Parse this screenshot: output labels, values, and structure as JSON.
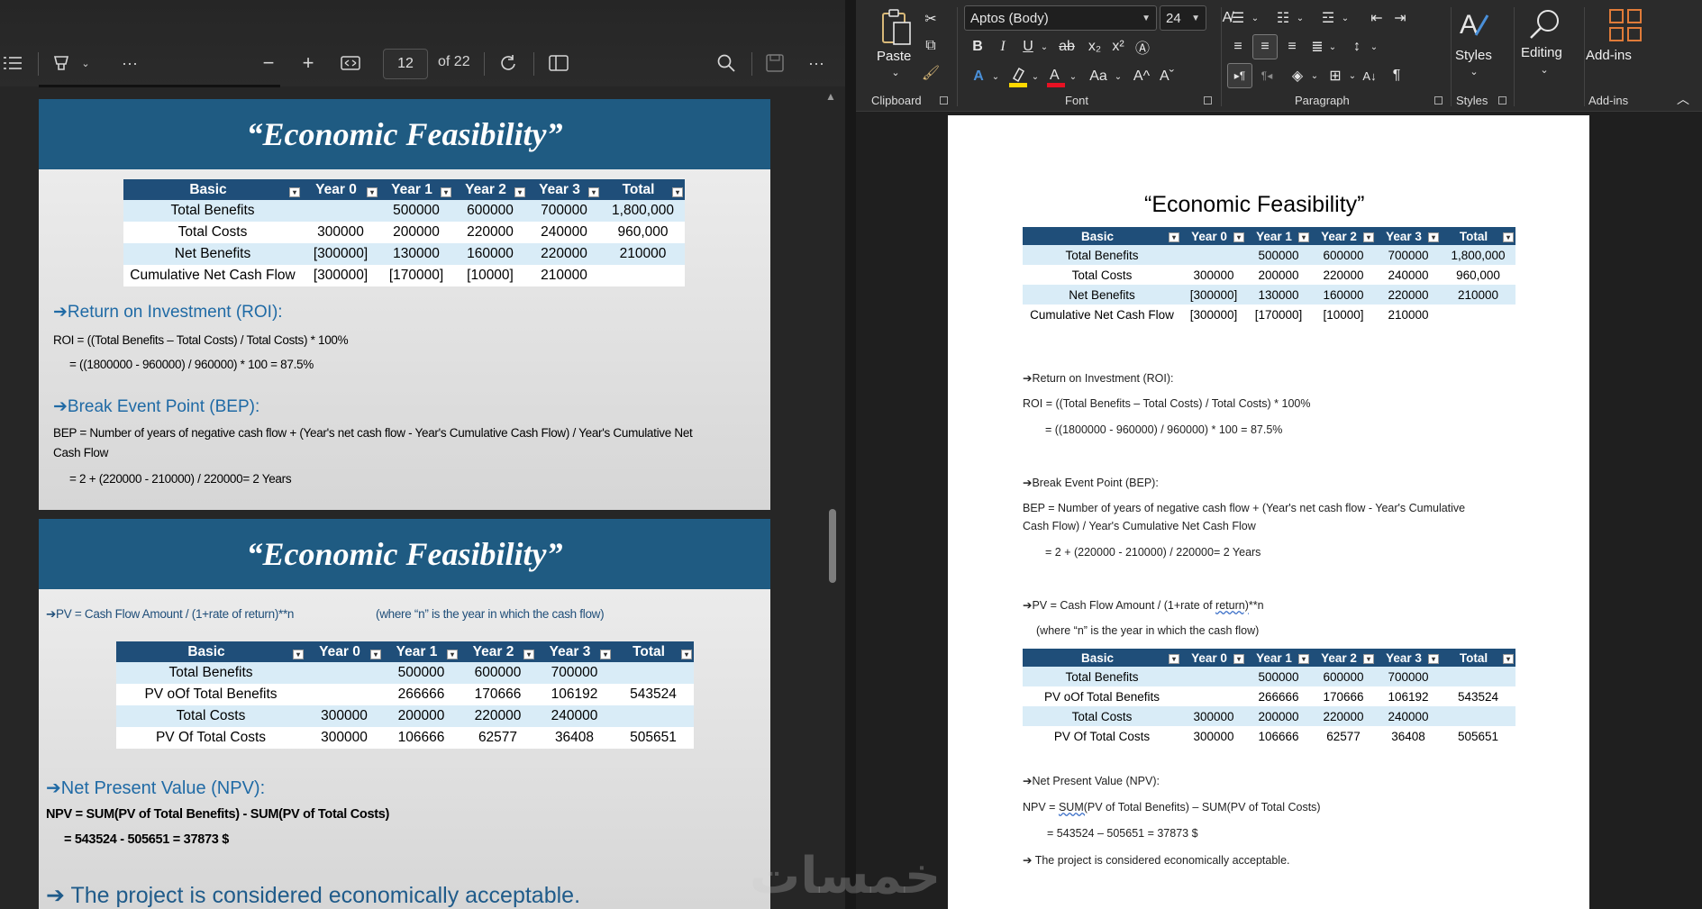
{
  "pdf_viewer": {
    "toolbar": {
      "contents_icon": "list-icon",
      "draw_icon": "highlighter-icon",
      "more_icon": "more-icon",
      "zoom_out_icon": "minus-icon",
      "zoom_in_icon": "plus-icon",
      "fit_icon": "fit-width-icon",
      "page_number": "12",
      "page_of": "of 22",
      "rotate_icon": "rotate-icon",
      "two_page_icon": "page-view-icon",
      "search_icon": "search-icon",
      "save_icon": "save-icon"
    },
    "slide1": {
      "title": "“Economic Feasibility”",
      "table": {
        "headers": [
          "Basic",
          "Year 0",
          "Year 1",
          "Year 2",
          "Year 3",
          "Total"
        ],
        "rows": [
          [
            "Total Benefits",
            "",
            "500000",
            "600000",
            "700000",
            "1,800,000"
          ],
          [
            "Total Costs",
            "300000",
            "200000",
            "220000",
            "240000",
            "960,000"
          ],
          [
            "Net Benefits",
            "[300000]",
            "130000",
            "160000",
            "220000",
            "210000"
          ],
          [
            "Cumulative Net Cash Flow",
            "[300000]",
            "[170000]",
            "[10000]",
            "210000",
            ""
          ]
        ]
      },
      "roi_heading": "➔Return on Investment (ROI):",
      "roi_formula": "ROI = ((Total Benefits – Total Costs) / Total Costs) * 100%",
      "roi_calc": "= ((1800000 - 960000) / 960000) * 100 = 87.5%",
      "bep_heading": "➔Break Event Point (BEP):",
      "bep_formula_1": "BEP = Number of years of negative cash flow + (Year's net cash flow - Year's Cumulative Cash Flow) / Year's Cumulative Net",
      "bep_formula_2": "Cash Flow",
      "bep_calc": "= 2 + (220000 - 210000) / 220000= 2 Years"
    },
    "slide2": {
      "title": "“Economic Feasibility”",
      "pv_formula": "➔PV = Cash Flow Amount / (1+rate of return)**n",
      "pv_note": "(where “n” is the year in which the cash flow)",
      "table": {
        "headers": [
          "Basic",
          "Year 0",
          "Year 1",
          "Year 2",
          "Year 3",
          "Total"
        ],
        "rows": [
          [
            "Total Benefits",
            "",
            "500000",
            "600000",
            "700000",
            ""
          ],
          [
            "PV oOf Total Benefits",
            "",
            "266666",
            "170666",
            "106192",
            "543524"
          ],
          [
            "Total Costs",
            "300000",
            "200000",
            "220000",
            "240000",
            ""
          ],
          [
            "PV Of Total Costs",
            "300000",
            "106666",
            "62577",
            "36408",
            "505651"
          ]
        ]
      },
      "npv_heading": "➔Net Present Value (NPV):",
      "npv_formula": "NPV = SUM(PV of Total Benefits) - SUM(PV of Total Costs)",
      "npv_calc": "= 543524 - 505651 = 37873 $",
      "conclusion": "➔ The project is considered economically acceptable."
    }
  },
  "word": {
    "ribbon": {
      "paste_label": "Paste",
      "clipboard_label": "Clipboard",
      "font_name": "Aptos (Body)",
      "font_size": "24",
      "font_label": "Font",
      "paragraph_label": "Paragraph",
      "styles_label": "Styles",
      "styles_button": "Styles",
      "editing_button": "Editing",
      "addins_button": "Add-ins",
      "addins_label": "Add-ins",
      "bold": "B",
      "italic": "I",
      "underline": "U",
      "strike": "ab",
      "subscript": "x₂",
      "superscript": "x²",
      "change_case": "Aa",
      "grow": "A^",
      "shrink": "Aˇ",
      "colors": {
        "highlight": "#ffd800",
        "font_color": "#e81123",
        "accent": "#4a90d9"
      }
    },
    "document": {
      "title": "“Economic Feasibility”",
      "table1": {
        "headers": [
          "Basic",
          "Year 0",
          "Year 1",
          "Year 2",
          "Year 3",
          "Total"
        ],
        "rows": [
          [
            "Total Benefits",
            "",
            "500000",
            "600000",
            "700000",
            "1,800,000"
          ],
          [
            "Total Costs",
            "300000",
            "200000",
            "220000",
            "240000",
            "960,000"
          ],
          [
            "Net Benefits",
            "[300000]",
            "130000",
            "160000",
            "220000",
            "210000"
          ],
          [
            "Cumulative Net Cash Flow",
            "[300000]",
            "[170000]",
            "[10000]",
            "210000",
            ""
          ]
        ]
      },
      "roi_heading": "➔Return on Investment (ROI):",
      "roi_formula": "ROI = ((Total Benefits – Total Costs) / Total Costs) * 100%",
      "roi_calc": "= ((1800000 - 960000) / 960000) * 100 = 87.5%",
      "bep_heading": "➔Break Event Point (BEP):",
      "bep_formula_1": "BEP = Number of years of negative cash flow + (Year's net cash flow - Year's Cumulative",
      "bep_formula_2": "Cash Flow) / Year's Cumulative Net Cash Flow",
      "bep_calc": "= 2 + (220000 - 210000) / 220000= 2 Years",
      "pv_formula_a": "➔PV = Cash Flow Amount / (1+rate of ",
      "pv_formula_b": "return)",
      "pv_formula_c": "**n",
      "pv_note": "(where “n” is the year in which the cash flow)",
      "table2": {
        "headers": [
          "Basic",
          "Year 0",
          "Year 1",
          "Year 2",
          "Year 3",
          "Total"
        ],
        "rows": [
          [
            "Total Benefits",
            "",
            "500000",
            "600000",
            "700000",
            ""
          ],
          [
            "PV oOf Total Benefits",
            "",
            "266666",
            "170666",
            "106192",
            "543524"
          ],
          [
            "Total Costs",
            "300000",
            "200000",
            "220000",
            "240000",
            ""
          ],
          [
            "PV Of Total Costs",
            "300000",
            "106666",
            "62577",
            "36408",
            "505651"
          ]
        ]
      },
      "npv_heading": "➔Net Present Value (NPV):",
      "npv_formula_a": "NPV = ",
      "npv_formula_b": "SUM(",
      "npv_formula_c": "PV of Total Benefits) – SUM(PV of Total Costs)",
      "npv_calc": "= 543524 – 505651 = 37873 $",
      "conclusion": "➔ The project is considered economically acceptable."
    }
  },
  "watermark": "خمسات"
}
